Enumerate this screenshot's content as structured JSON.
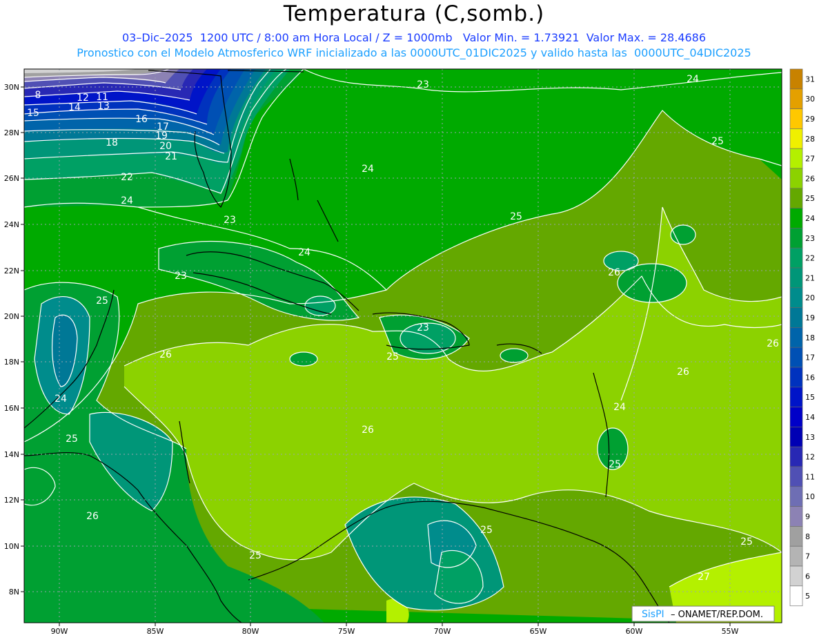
{
  "title": "Temperatura (C,somb.)",
  "subtitle_1": "03–Dic–2025  1200 UTC / 8:00 am Hora Local / Z = 1000mb   Valor Min. = 1.73921  Valor Max. = 28.4686",
  "subtitle_2": "Pronostico con el Modelo Atmosferico WRF inicializado a las 0000UTC_01DIC2025 y valido hasta las  0000UTC_04DIC2025",
  "credit": {
    "brand": "SisPI",
    "agency": " – ONAMET/REP.DOM."
  },
  "lat_labels": [
    "30N",
    "28N",
    "26N",
    "24N",
    "22N",
    "20N",
    "18N",
    "16N",
    "14N",
    "12N",
    "10N",
    "8N"
  ],
  "lon_labels": [
    "90W",
    "85W",
    "80W",
    "75W",
    "70W",
    "65W",
    "60W",
    "55W"
  ],
  "colorbar": {
    "levels": [
      "31",
      "30",
      "29",
      "28",
      "27",
      "26",
      "25",
      "24",
      "23",
      "22",
      "21",
      "20",
      "19",
      "18",
      "17",
      "16",
      "15",
      "14",
      "13",
      "12",
      "11",
      "10",
      "9",
      "8",
      "7",
      "6",
      "5"
    ],
    "colors": [
      "#c88200",
      "#e4a000",
      "#ffc800",
      "#f0f000",
      "#b4f000",
      "#8cd200",
      "#64a800",
      "#00aa00",
      "#00a032",
      "#00a064",
      "#009678",
      "#008c8c",
      "#007896",
      "#0064aa",
      "#0050b4",
      "#0032be",
      "#0014c8",
      "#0000c8",
      "#0000b4",
      "#2828b4",
      "#5050b4",
      "#6e6eb4",
      "#8c82b4",
      "#a0a0a0",
      "#b4b4b4",
      "#d2d2d2",
      "#ffffff"
    ]
  },
  "contour_labels": [
    {
      "t": "8"
    },
    {
      "t": "12"
    },
    {
      "t": "11"
    },
    {
      "t": "15"
    },
    {
      "t": "14"
    },
    {
      "t": "13"
    },
    {
      "t": "16"
    },
    {
      "t": "17"
    },
    {
      "t": "19"
    },
    {
      "t": "18"
    },
    {
      "t": "20"
    },
    {
      "t": "21"
    },
    {
      "t": "22"
    },
    {
      "t": "24"
    },
    {
      "t": "23"
    },
    {
      "t": "23"
    },
    {
      "t": "24"
    },
    {
      "t": "24"
    },
    {
      "t": "25"
    },
    {
      "t": "25"
    },
    {
      "t": "24"
    },
    {
      "t": "23"
    },
    {
      "t": "25"
    },
    {
      "t": "23"
    },
    {
      "t": "26"
    },
    {
      "t": "25"
    },
    {
      "t": "26"
    },
    {
      "t": "26"
    },
    {
      "t": "26"
    },
    {
      "t": "26"
    },
    {
      "t": "24"
    },
    {
      "t": "25"
    },
    {
      "t": "25"
    },
    {
      "t": "26"
    },
    {
      "t": "25"
    },
    {
      "t": "25"
    },
    {
      "t": "27"
    },
    {
      "t": "25"
    },
    {
      "t": "24"
    }
  ]
}
